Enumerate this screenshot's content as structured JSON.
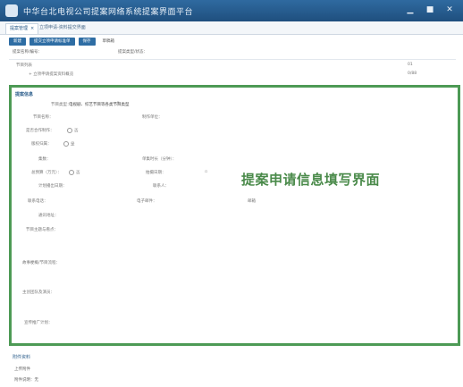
{
  "window": {
    "title": "中华台北电视公司提案网络系统提案界面平台",
    "controls": [
      "minimize-icon",
      "maximize-icon",
      "close-icon"
    ]
  },
  "tabs": [
    {
      "label": "提案管理",
      "close": "×"
    },
    {
      "label": "立项申请-资料提交界面"
    }
  ],
  "toolbar": {
    "buttons": [
      "新建",
      "提交立项申请标准单",
      "保存"
    ],
    "extra": "草稿箱"
  },
  "filters": {
    "left_label": "提案名称/编号：",
    "right_label": "提案类型/状态："
  },
  "tree": {
    "row1_label": "节目列表",
    "row1_right": "01",
    "row2_label": "+ 立项申请提案资料概览",
    "row2_right": "0/88"
  },
  "form": {
    "section_title": "提案信息",
    "fields": {
      "type_label": "节目类型：",
      "type_value": "电视剧、综艺节目等各类节目类型",
      "name_label": "节目名称：",
      "producer_label": "制作单位：",
      "coop_label": "是否合作制作：",
      "coop_value": "否",
      "copyright_label": "版权归属：",
      "copyright_value": "是",
      "episodes_label": "集数：",
      "duration_label": "单集时长（分钟）：",
      "budget_label": "总预算（万元）：",
      "budget_value": "否",
      "start_label": "拍摄日期：",
      "end_label": "计划播出日期：",
      "contact_label": "联系人：",
      "phone_label": "联系电话：",
      "email_label": "电子邮件：",
      "email_value": "邮箱",
      "address_label": "通讯地址：",
      "summary_label": "节目主题与看点：",
      "synopsis_label": "故事梗概/节目流程：",
      "team_label": "主创团队及演员：",
      "plan_label": "宣传推广计划："
    },
    "overlay_title": "提案申请信息填写界面"
  },
  "bottom": {
    "section_title": "附件资料",
    "line1": "上传附件",
    "line2": "附件说明：无"
  }
}
